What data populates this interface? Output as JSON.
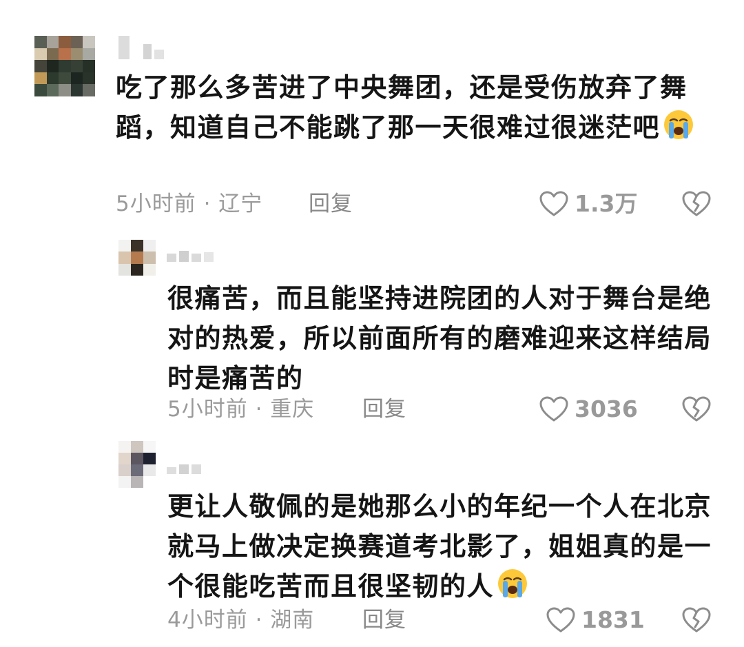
{
  "comments": [
    {
      "text": "吃了那么多苦进了中央舞团，还是受伤放弃了舞蹈，知道自己不能跳了那一天很难过很迷茫吧",
      "emoji": "loudly-crying-face",
      "time_location": "5小时前 · 辽宁",
      "reply_label": "回复",
      "like_count": "1.3万"
    },
    {
      "text": "很痛苦，而且能坚持进院团的人对于舞台是绝对的热爱，所以前面所有的磨难迎来这样结局时是痛苦的",
      "time_location": "5小时前 · 重庆",
      "reply_label": "回复",
      "like_count": "3036"
    },
    {
      "text": "更让人敬佩的是她那么小的年纪一个人在北京就马上做决定换赛道考北影了，姐姐真的是一个很能吃苦而且很坚韧的人",
      "emoji": "loudly-crying-face",
      "time_location": "4小时前 · 湖南",
      "reply_label": "回复",
      "like_count": "1831"
    }
  ],
  "colors": {
    "text": "#151515",
    "meta": "#9a9a9a",
    "icon": "#8c8c8c"
  }
}
